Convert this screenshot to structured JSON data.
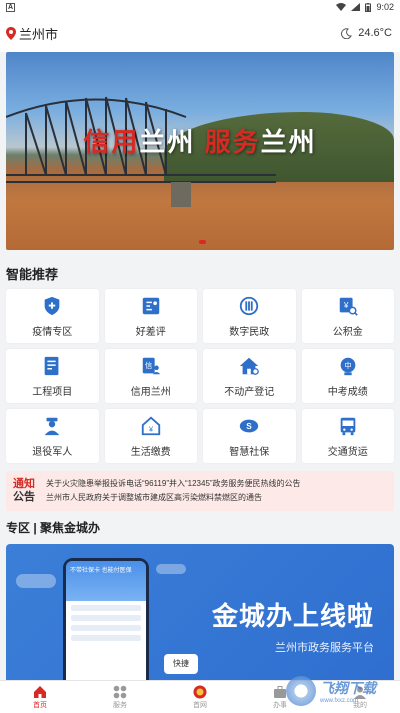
{
  "status_bar": {
    "app_letter": "A",
    "time": "9:02"
  },
  "header": {
    "city": "兰州市",
    "temperature": "24.6°C"
  },
  "banner": {
    "slogan_part1_red": "信用",
    "slogan_part1_white": "兰州",
    "slogan_part2_red": "服务",
    "slogan_part2_white": "兰州"
  },
  "recommend": {
    "title": "智能推荐",
    "items": [
      {
        "label": "疫情专区",
        "icon": "shield-plus-icon"
      },
      {
        "label": "好差评",
        "icon": "rating-card-icon"
      },
      {
        "label": "数字民政",
        "icon": "civil-affairs-icon"
      },
      {
        "label": "公积金",
        "icon": "housing-fund-icon"
      },
      {
        "label": "工程项目",
        "icon": "document-list-icon"
      },
      {
        "label": "信用兰州",
        "icon": "credit-person-icon"
      },
      {
        "label": "不动产登记",
        "icon": "house-register-icon"
      },
      {
        "label": "中考成绩",
        "icon": "exam-score-icon"
      },
      {
        "label": "退役军人",
        "icon": "veteran-icon"
      },
      {
        "label": "生活缴费",
        "icon": "utility-payment-icon"
      },
      {
        "label": "智慧社保",
        "icon": "social-security-icon"
      },
      {
        "label": "交通货运",
        "icon": "bus-icon"
      }
    ]
  },
  "notice": {
    "tag_line1": "通知",
    "tag_line2": "公告",
    "lines": [
      "关于火灾隐患举报投诉电话“96119”并入“12345”政务服务便民热线的公告",
      "兰州市人民政府关于调整城市建成区高污染燃料禁燃区的通告"
    ]
  },
  "zone": {
    "title": "专区 | 聚焦金城办",
    "headline": "金城办上线啦",
    "subtitle": "兰州市政务服务平台",
    "bubble": "快捷",
    "phone_text": "不带社保卡 也能付医保"
  },
  "tabbar": {
    "items": [
      {
        "label": "首页",
        "icon": "home-icon",
        "active": true
      },
      {
        "label": "服务",
        "icon": "grid-icon",
        "active": false
      },
      {
        "label": "首网",
        "icon": "emblem-icon",
        "active": false
      },
      {
        "label": "办事",
        "icon": "briefcase-icon",
        "active": false
      },
      {
        "label": "我的",
        "icon": "user-icon",
        "active": false
      }
    ]
  },
  "colors": {
    "accent": "#d62a22",
    "icon_blue": "#2e6fc9",
    "notice_bg": "#fde9e7",
    "zone_bg": "#3b7fd8"
  },
  "watermark": {
    "text": "飞翔下载",
    "subtext": "www.fxxz.com"
  }
}
